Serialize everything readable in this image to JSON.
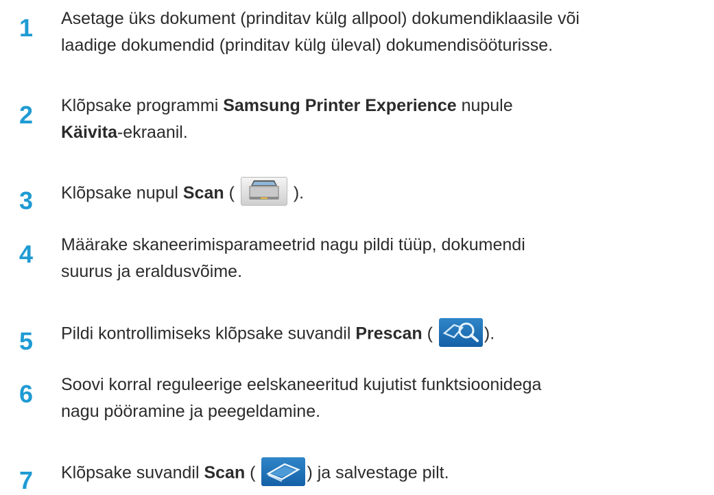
{
  "steps": [
    {
      "number": "1",
      "line1": "Asetage üks dokument (prinditav külg allpool) dokumendiklaasile või",
      "line2": "laadige dokumendid (prinditav külg üleval) dokumendisööturisse."
    },
    {
      "number": "2",
      "pre": "Klõpsake programmi ",
      "bold1": "Samsung Printer Experience",
      "mid": " nupule",
      "bold2": "Käivita",
      "post": "-ekraanil."
    },
    {
      "number": "3",
      "pre": "Klõpsake nupul ",
      "bold": "Scan",
      "open": " (",
      "icon": "scanner-icon",
      "close": " )."
    },
    {
      "number": "4",
      "line1": "Määrake skaneerimisparameetrid nagu pildi tüüp, dokumendi",
      "line2": "suurus ja eraldusvõime."
    },
    {
      "number": "5",
      "pre": "Pildi kontrollimiseks klõpsake suvandil ",
      "bold": "Prescan",
      "open": " (",
      "icon": "prescan-magnifier-icon",
      "close": ")."
    },
    {
      "number": "6",
      "line1": "Soovi korral reguleerige eelskaneeritud kujutist funktsioonidega",
      "line2": "nagu pööramine ja peegeldamine."
    },
    {
      "number": "7",
      "pre": "Klõpsake suvandil ",
      "bold": "Scan",
      "open": " (",
      "icon": "scan-flatbed-icon",
      "close": ") ja salvestage pilt."
    }
  ],
  "colors": {
    "step_number": "#1f9bd3",
    "body_text": "#2b2b2b",
    "icon_blue": "#1a6bb5"
  }
}
